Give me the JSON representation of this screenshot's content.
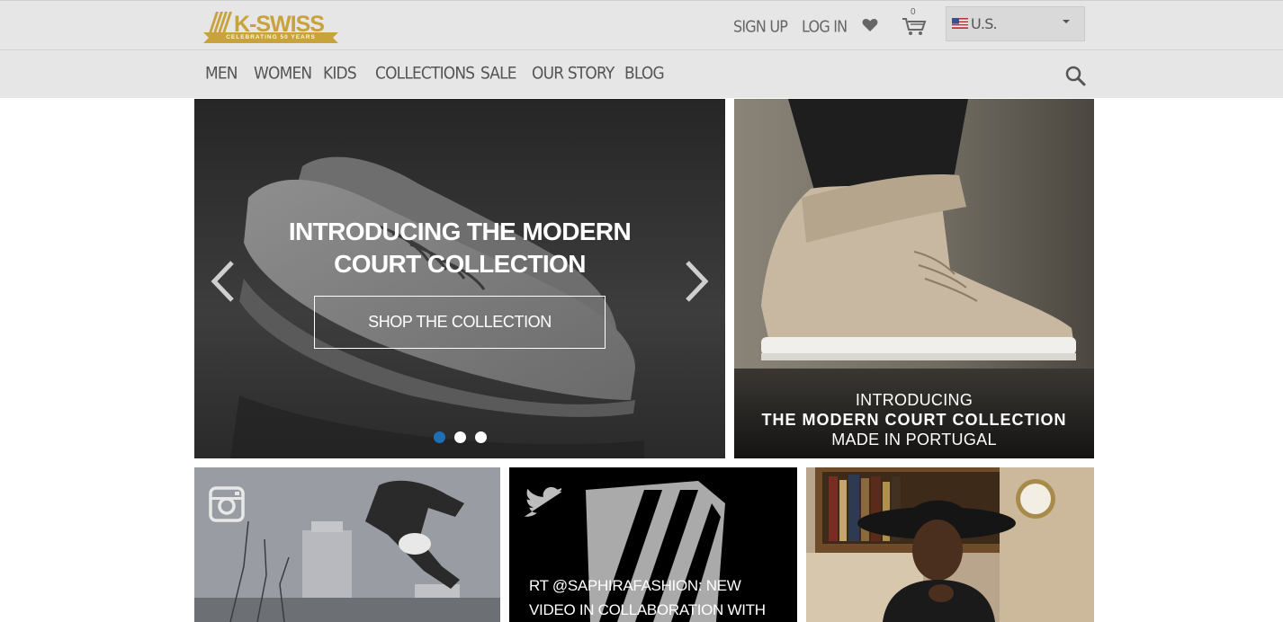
{
  "brand": {
    "name": "K-SWISS",
    "tagline": "CELEBRATING 50 YEARS"
  },
  "header": {
    "signup_label": "SIGN UP",
    "login_label": "LOG IN",
    "cart_count": "0",
    "region_label": "U.S."
  },
  "nav": {
    "items": [
      "MEN",
      "WOMEN",
      "KIDS",
      "COLLECTIONS",
      "SALE",
      "OUR STORY",
      "BLOG"
    ]
  },
  "hero": {
    "title_line1": "INTRODUCING THE MODERN",
    "title_line2": "COURT COLLECTION",
    "button_label": "SHOP THE COLLECTION",
    "slide_count": 3,
    "active_slide": 1
  },
  "promo": {
    "line1": "INTRODUCING",
    "line2": "THE MODERN COURT COLLECTION",
    "line3": "MADE IN PORTUGAL"
  },
  "tiles": {
    "twitter_text": "RT @SAPHIRAFASHION: NEW VIDEO IN COLLABORATION WITH"
  },
  "colors": {
    "brand_gold": "#c8a23a",
    "active_dot": "#1f6fb5",
    "bar_bg": "#e6e6e6"
  }
}
